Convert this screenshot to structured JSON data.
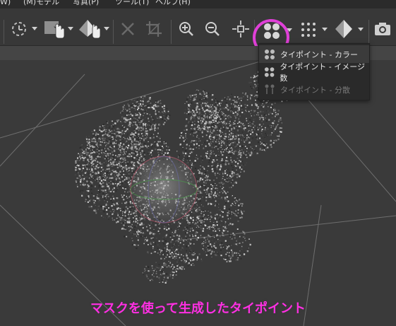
{
  "menu": {
    "items": [
      "W)",
      "(M)モデル",
      "写真(P)",
      "ツール(T)",
      "ヘルプ(H)"
    ]
  },
  "toolbar": {
    "icons": [
      "rotate-select-icon",
      "rect-select-hand-icon",
      "shape-select-icon",
      "delete-icon",
      "crop-icon",
      "zoom-in-icon",
      "zoom-out-icon",
      "fit-icon",
      "tie-points-icon",
      "dense-points-icon",
      "mesh-icon",
      "camera-icon"
    ]
  },
  "dropdown": {
    "items": [
      {
        "label": "タイポイント - カラー",
        "state": "hover"
      },
      {
        "label": "タイポイント - イメージ数",
        "state": "normal"
      },
      {
        "label": "タイポイント - 分散",
        "state": "disabled"
      }
    ]
  },
  "annotation": {
    "caption": "マスクを使って生成したタイポイント",
    "ring_color": "#e040d8",
    "caption_color": "#ff2fe3"
  },
  "colors": {
    "toolbar_bg": "#383838",
    "viewport_bg": "#3a3a3a",
    "menu_bg": "#2a2a2a"
  }
}
